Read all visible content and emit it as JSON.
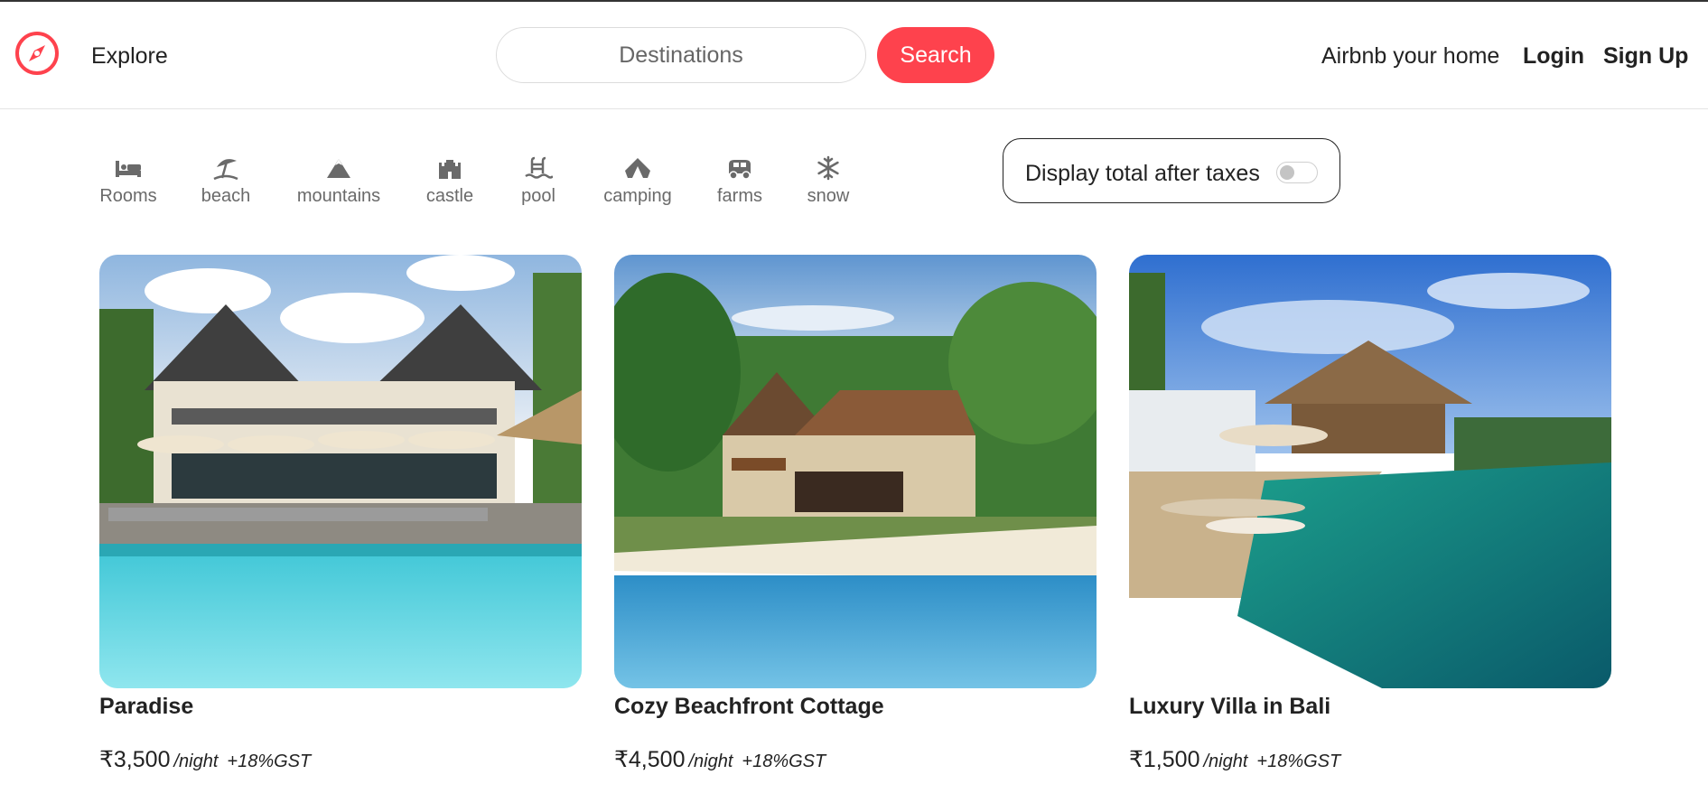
{
  "navbar": {
    "explore_label": "Explore",
    "search": {
      "placeholder": "Destinations",
      "button_label": "Search"
    },
    "host_label": "Airbnb your home",
    "login_label": "Login",
    "signup_label": "Sign Up",
    "accent_color": "#fe424d"
  },
  "filters": [
    {
      "label": "Rooms",
      "icon": "bed-icon"
    },
    {
      "label": "beach",
      "icon": "umbrella-beach-icon"
    },
    {
      "label": "mountains",
      "icon": "mountain-icon"
    },
    {
      "label": "castle",
      "icon": "castle-icon"
    },
    {
      "label": "pool",
      "icon": "pool-icon"
    },
    {
      "label": "camping",
      "icon": "campground-icon"
    },
    {
      "label": "farms",
      "icon": "tractor-icon"
    },
    {
      "label": "snow",
      "icon": "snowflake-icon"
    }
  ],
  "tax_toggle": {
    "label": "Display total after taxes",
    "enabled": false
  },
  "listings": [
    {
      "title": "Paradise",
      "price": "₹3,500",
      "per_night": "/night",
      "tax_note": "+18%GST"
    },
    {
      "title": "Cozy Beachfront Cottage",
      "price": "₹4,500",
      "per_night": "/night",
      "tax_note": "+18%GST"
    },
    {
      "title": "Luxury Villa in Bali",
      "price": "₹1,500",
      "per_night": "/night",
      "tax_note": "+18%GST"
    }
  ]
}
